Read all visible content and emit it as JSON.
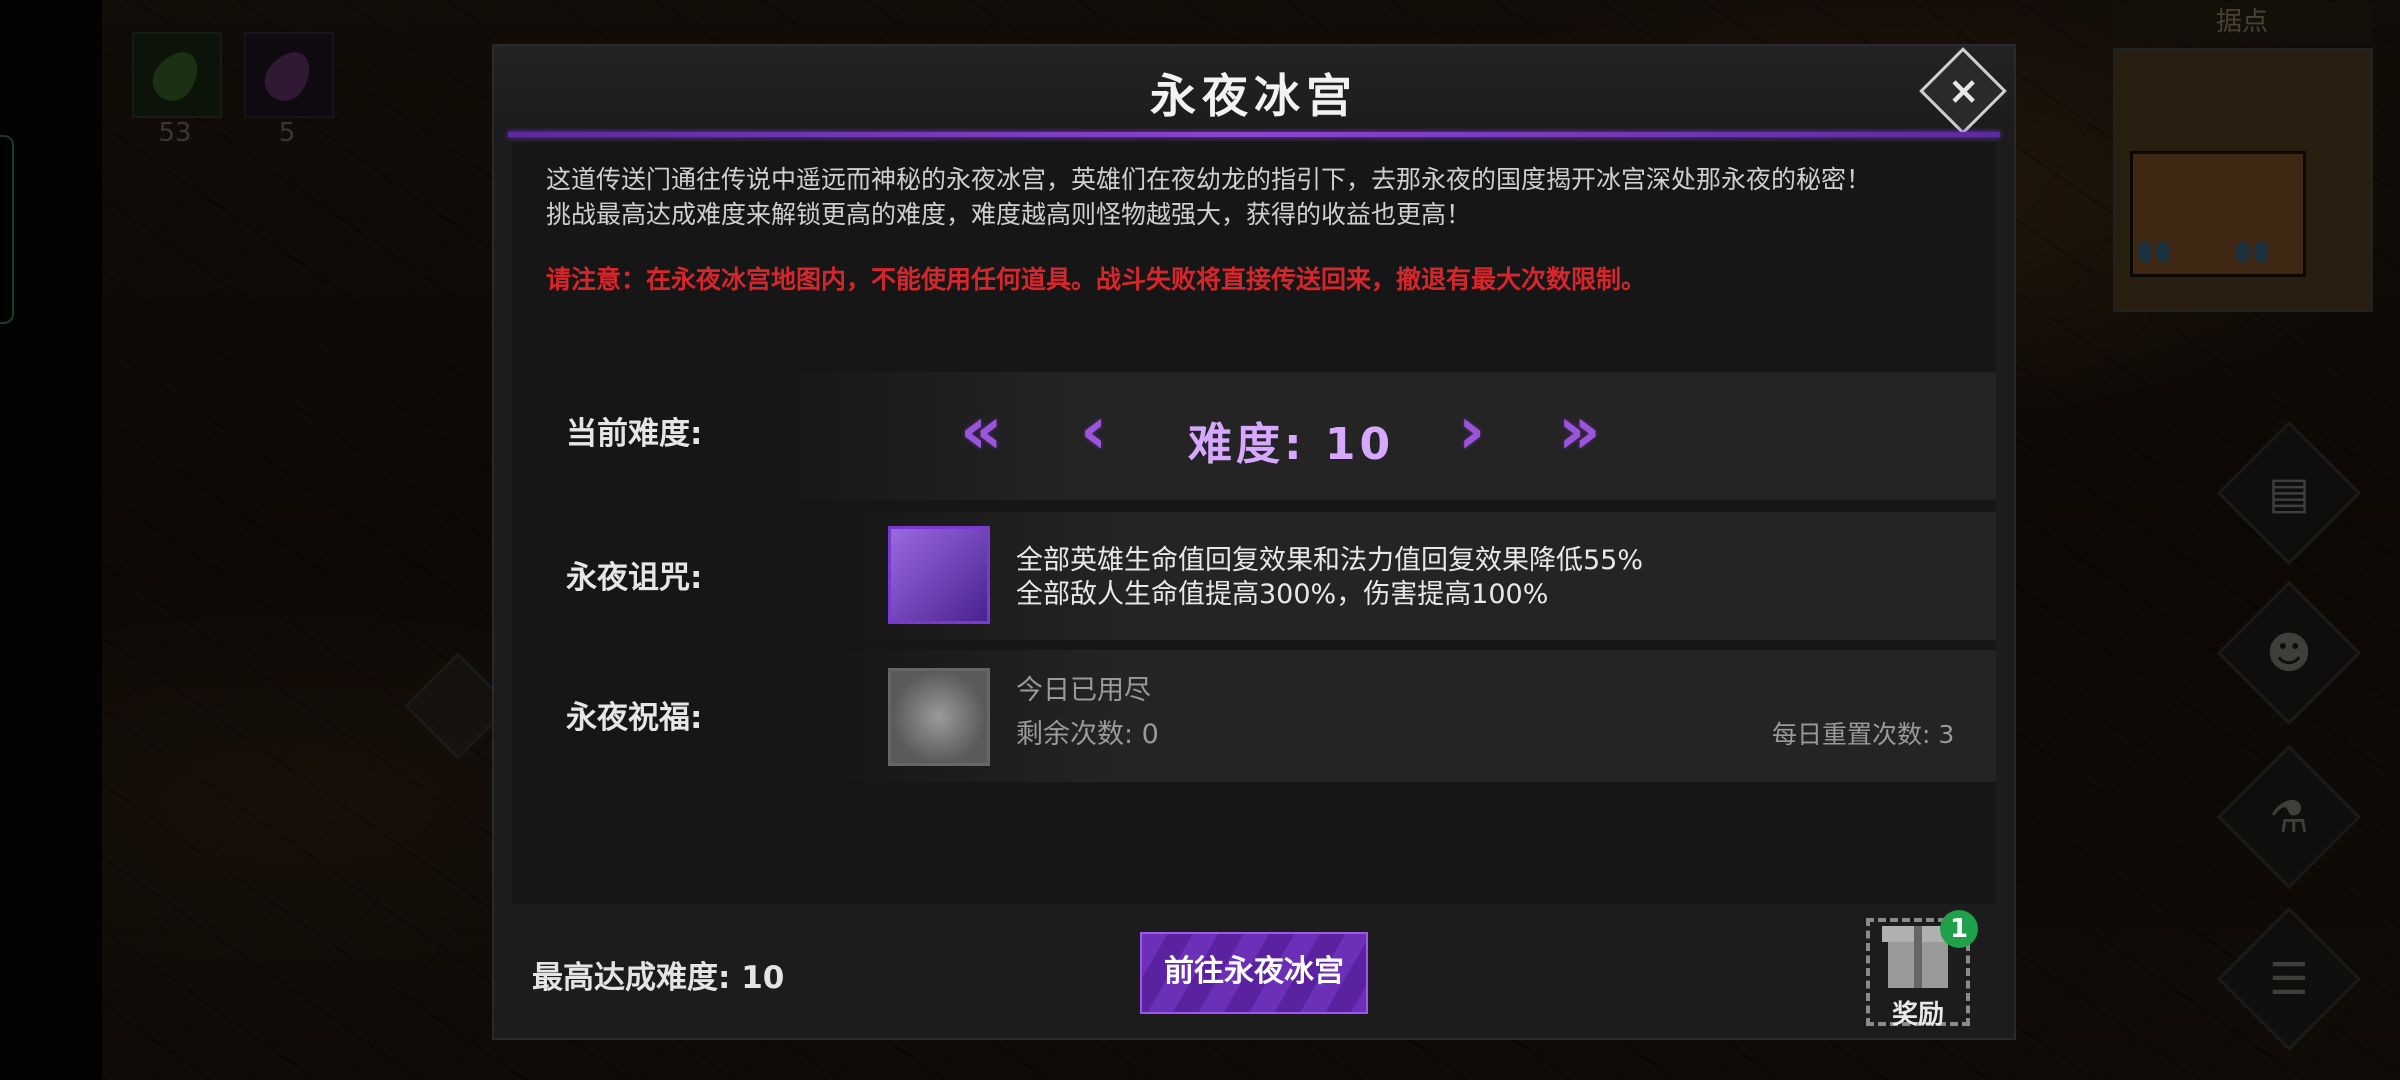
{
  "background": {
    "resources": [
      {
        "name": "green-gem-icon",
        "count": "53"
      },
      {
        "name": "purple-gem-icon",
        "count": "5"
      }
    ],
    "minimap_title": "据点",
    "right_nav": [
      "quest-icon",
      "party-icon",
      "potion-icon",
      "menu-list-icon"
    ]
  },
  "modal": {
    "title": "永夜冰宫",
    "close_icon": "close-icon",
    "description_line1": "这道传送门通往传说中遥远而神秘的永夜冰宫，英雄们在夜幼龙的指引下，去那永夜的国度揭开冰宫深处那永夜的秘密！",
    "description_line2": "挑战最高达成难度来解锁更高的难度，难度越高则怪物越强大，获得的收益也更高！",
    "warning": "请注意：在永夜冰宫地图内，不能使用任何道具。战斗失败将直接传送回来，撤退有最大次数限制。",
    "difficulty": {
      "label": "当前难度:",
      "value_text": "难度: 10",
      "first_icon": "double-chevron-left-icon",
      "prev_icon": "chevron-left-icon",
      "next_icon": "chevron-right-icon",
      "last_icon": "double-chevron-right-icon"
    },
    "curse": {
      "label": "永夜诅咒:",
      "icon": "bat-moon-icon",
      "line1": "全部英雄生命值回复效果和法力值回复效果降低55%",
      "line2": "全部敌人生命值提高300%，伤害提高100%"
    },
    "blessing": {
      "label": "永夜祝福:",
      "icon": "swirl-icon",
      "status": "今日已用尽",
      "remaining": "剩余次数: 0",
      "daily_reset": "每日重置次数: 3"
    },
    "footer": {
      "max_difficulty": "最高达成难度: 10",
      "go_button": "前往永夜冰宫",
      "reward_label": "奖励",
      "reward_badge": "1"
    }
  },
  "colors": {
    "accent_purple": "#8a45d0",
    "warning_red": "#d7262b",
    "badge_green": "#1fa04a"
  }
}
